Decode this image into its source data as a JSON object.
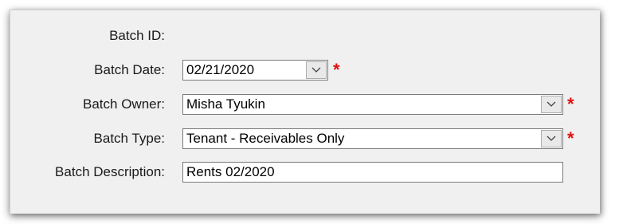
{
  "form": {
    "batch_id": {
      "label": "Batch ID:",
      "value": ""
    },
    "batch_date": {
      "label": "Batch Date:",
      "value": "02/21/2020",
      "required_marker": "*"
    },
    "batch_owner": {
      "label": "Batch Owner:",
      "value": "Misha Tyukin",
      "required_marker": "*"
    },
    "batch_type": {
      "label": "Batch Type:",
      "value": "Tenant - Receivables Only",
      "required_marker": "*"
    },
    "batch_description": {
      "label": "Batch Description:",
      "value": "Rents 02/2020"
    }
  },
  "icons": {
    "dropdown": "chevron-down-icon"
  },
  "colors": {
    "required": "#e01010",
    "panel_background": "#f0f0f0"
  }
}
